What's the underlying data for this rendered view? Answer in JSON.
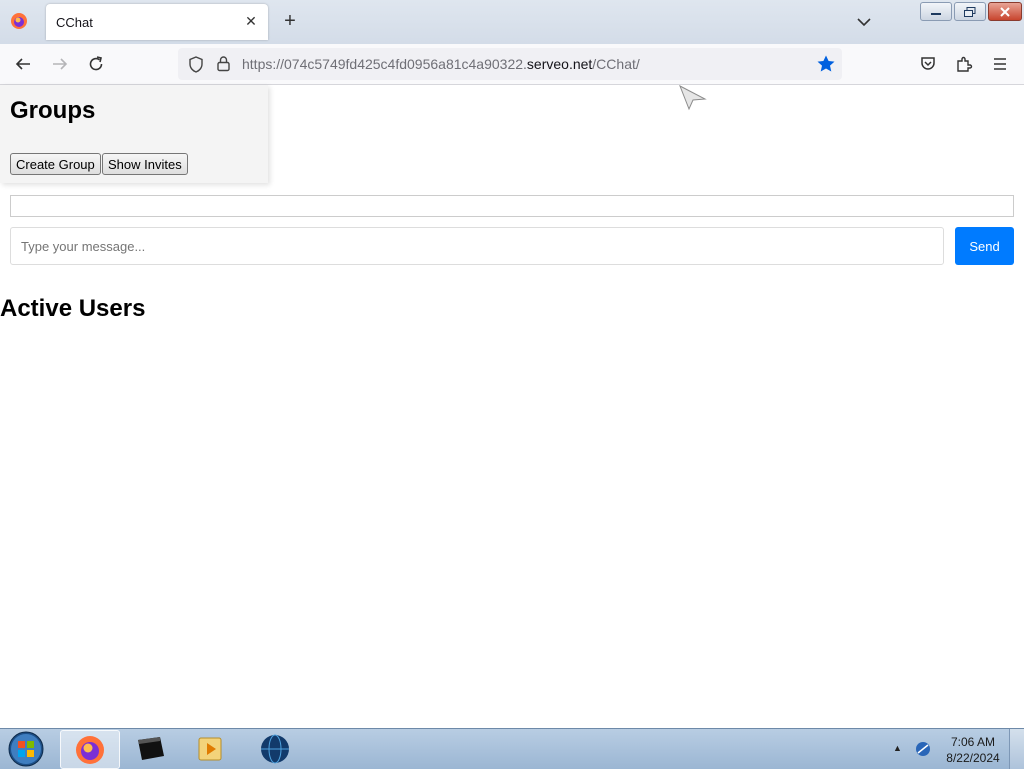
{
  "browser": {
    "tab_title": "CChat",
    "url_prefix": "https://074c5749fd425c4fd0956a81c4a90322.",
    "url_domain": "serveo.net",
    "url_path": "/CChat/"
  },
  "groups": {
    "title": "Groups",
    "create_label": "Create Group",
    "invites_label": "Show Invites"
  },
  "chat": {
    "placeholder": "Type your message...",
    "send_label": "Send"
  },
  "users": {
    "title": "Active Users"
  },
  "taskbar": {
    "time": "7:06 AM",
    "date": "8/22/2024"
  },
  "colors": {
    "send_button": "#007bff",
    "bookmark_star": "#0060df"
  }
}
